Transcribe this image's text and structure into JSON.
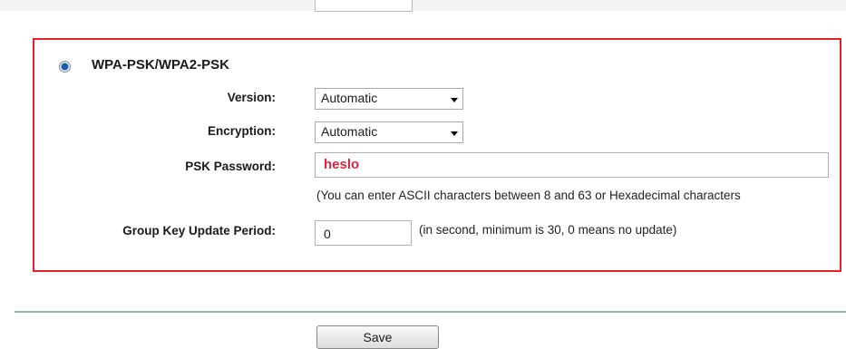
{
  "security": {
    "mode_label": "WPA-PSK/WPA2-PSK",
    "mode_selected": true,
    "version": {
      "label": "Version:",
      "value": "Automatic"
    },
    "encryption": {
      "label": "Encryption:",
      "value": "Automatic"
    },
    "psk_password": {
      "label": "PSK Password:",
      "value": "heslo",
      "hint": "(You can enter ASCII characters between 8 and 63 or Hexadecimal characters"
    },
    "group_key_update": {
      "label": "Group Key Update Period:",
      "value": "0",
      "hint": "(in second, minimum is 30, 0 means no update)"
    }
  },
  "actions": {
    "save_label": "Save"
  },
  "colors": {
    "highlight_border": "#e3202c",
    "password_text": "#d7263d",
    "divider": "#8fb79f"
  }
}
